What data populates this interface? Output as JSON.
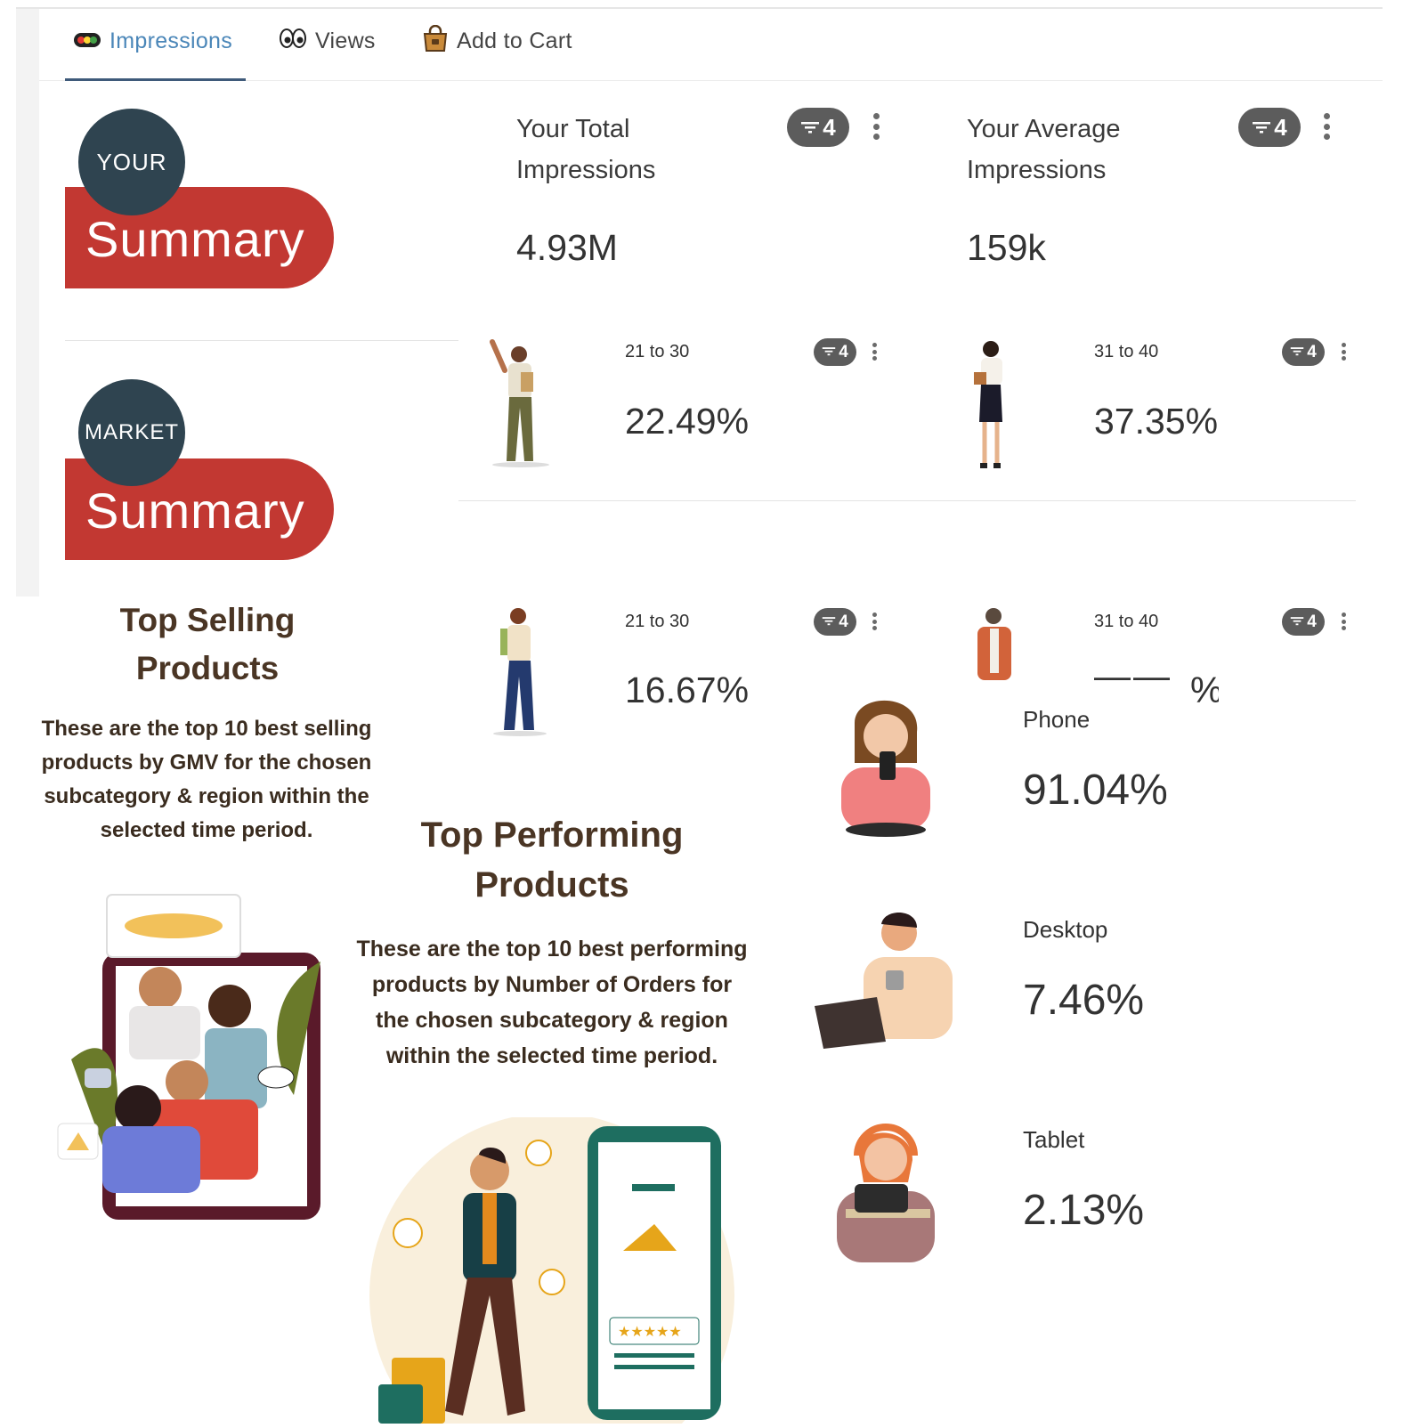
{
  "tabs": [
    {
      "label": "Impressions",
      "icon": "traffic-light-icon",
      "active": true
    },
    {
      "label": "Views",
      "icon": "eyes-icon",
      "active": false
    },
    {
      "label": "Add to Cart",
      "icon": "shopping-bag-icon",
      "active": false
    }
  ],
  "your_summary": {
    "circle": "YOUR",
    "bar": "Summary"
  },
  "market_summary": {
    "circle": "MARKET",
    "bar": "Summary"
  },
  "cards": {
    "total": {
      "title_line1": "Your Total",
      "title_line2": "Impressions",
      "value": "4.93M",
      "filter_count": "4"
    },
    "average": {
      "title_line1": "Your Average",
      "title_line2": "Impressions",
      "value": "159k",
      "filter_count": "4"
    }
  },
  "age_your": [
    {
      "label": "21 to 30",
      "value": "22.49%",
      "filter_count": "4"
    },
    {
      "label": "31 to 40",
      "value": "37.35%",
      "filter_count": "4"
    }
  ],
  "age_market": [
    {
      "label": "21 to 30",
      "value": "16.67%",
      "filter_count": "4"
    },
    {
      "label": "31 to 40",
      "value": "%",
      "filter_count": "4"
    }
  ],
  "top_selling": {
    "title_line1": "Top Selling",
    "title_line2": "Products",
    "desc_lines": [
      "These are the top 10 best selling",
      "products by GMV for the chosen",
      "subcategory & region within the",
      "selected time period."
    ]
  },
  "top_performing": {
    "title_line1": "Top Performing",
    "title_line2": "Products",
    "desc_lines": [
      "These are the top 10 best performing",
      "products by Number of Orders for",
      "the chosen subcategory & region",
      "within the selected time period."
    ]
  },
  "devices": [
    {
      "label": "Phone",
      "value": "91.04%"
    },
    {
      "label": "Desktop",
      "value": "7.46%"
    },
    {
      "label": "Tablet",
      "value": "2.13%"
    }
  ],
  "colors": {
    "brand_red": "#c23832",
    "dark_slate": "#2f4450",
    "active_tab": "#4a86b8",
    "heading_brown": "#4a3524"
  }
}
